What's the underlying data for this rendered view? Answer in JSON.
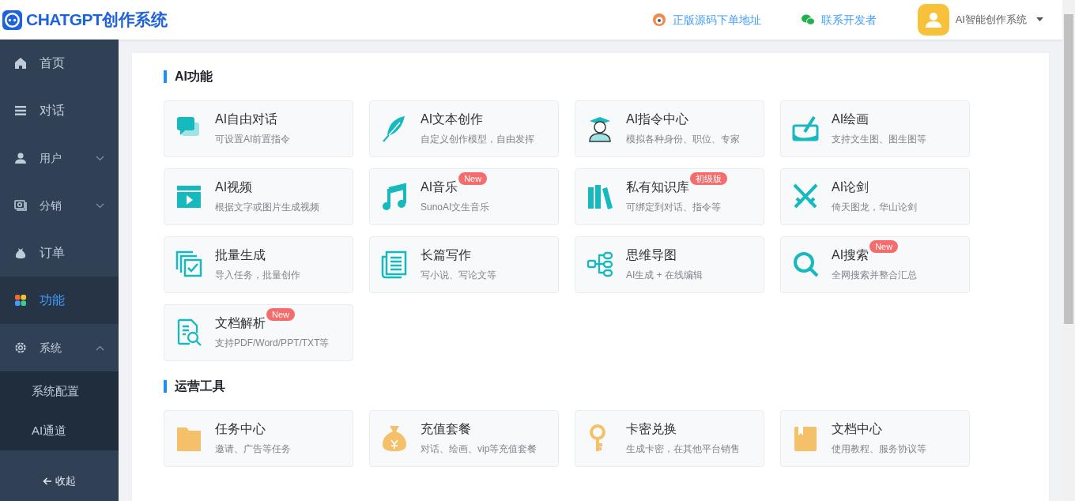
{
  "header": {
    "logo_text": "CHATGPT创作系统",
    "links": [
      {
        "label": "正版源码下单地址"
      },
      {
        "label": "联系开发者"
      }
    ],
    "user": {
      "name": "AI智能创作系统"
    }
  },
  "sidebar": {
    "items": [
      {
        "label": "首页",
        "selected": false
      },
      {
        "label": "对话",
        "selected": false
      },
      {
        "label": "用户",
        "selected": false,
        "expanded": false
      },
      {
        "label": "分销",
        "selected": false,
        "expanded": false
      },
      {
        "label": "订单",
        "selected": false
      },
      {
        "label": "功能",
        "selected": true
      },
      {
        "label": "系统",
        "selected": false,
        "expanded": true,
        "children": [
          {
            "label": "系统配置"
          },
          {
            "label": "AI通道"
          }
        ]
      }
    ],
    "collapse": "收起"
  },
  "sections": [
    {
      "title": "AI功能",
      "cards": [
        {
          "title": "AI自由对话",
          "desc": "可设置AI前置指令"
        },
        {
          "title": "AI文本创作",
          "desc": "自定义创作模型，自由发挥"
        },
        {
          "title": "AI指令中心",
          "desc": "模拟各种身份、职位、专家"
        },
        {
          "title": "AI绘画",
          "desc": "支持文生图、图生图等"
        },
        {
          "title": "AI视频",
          "desc": "根据文字或图片生成视频"
        },
        {
          "title": "AI音乐",
          "desc": "SunoAI文生音乐",
          "badge": "New"
        },
        {
          "title": "私有知识库",
          "desc": "可绑定到对话、指令等",
          "badge": "初级版"
        },
        {
          "title": "AI论剑",
          "desc": "倚天图龙，华山论剑"
        },
        {
          "title": "批量生成",
          "desc": "导入任务，批量创作"
        },
        {
          "title": "长篇写作",
          "desc": "写小说、写论文等"
        },
        {
          "title": "思维导图",
          "desc": "AI生成 + 在线编辑"
        },
        {
          "title": "AI搜索",
          "desc": "全网搜索并整合汇总",
          "badge": "New"
        },
        {
          "title": "文档解析",
          "desc": "支持PDF/Word/PPT/TXT等",
          "badge": "New"
        }
      ]
    },
    {
      "title": "运营工具",
      "cards": [
        {
          "title": "任务中心",
          "desc": "邀请、广告等任务"
        },
        {
          "title": "充值套餐",
          "desc": "对话、绘画、vip等充值套餐"
        },
        {
          "title": "卡密兑换",
          "desc": "生成卡密，在其他平台销售"
        },
        {
          "title": "文档中心",
          "desc": "使用教程、服务协议等"
        }
      ]
    }
  ]
}
